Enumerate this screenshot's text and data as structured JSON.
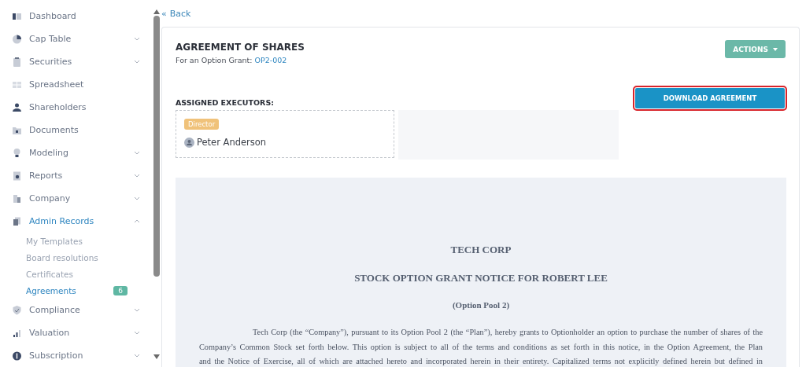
{
  "sidebar": {
    "items": [
      {
        "label": "Dashboard",
        "has_submenu": false,
        "expanded": false,
        "selected": false
      },
      {
        "label": "Cap Table",
        "has_submenu": true,
        "expanded": false,
        "selected": false
      },
      {
        "label": "Securities",
        "has_submenu": true,
        "expanded": false,
        "selected": false
      },
      {
        "label": "Spreadsheet",
        "has_submenu": false,
        "expanded": false,
        "selected": false
      },
      {
        "label": "Shareholders",
        "has_submenu": false,
        "expanded": false,
        "selected": false
      },
      {
        "label": "Documents",
        "has_submenu": false,
        "expanded": false,
        "selected": false
      },
      {
        "label": "Modeling",
        "has_submenu": true,
        "expanded": false,
        "selected": false
      },
      {
        "label": "Reports",
        "has_submenu": true,
        "expanded": false,
        "selected": false
      },
      {
        "label": "Company",
        "has_submenu": true,
        "expanded": false,
        "selected": false
      },
      {
        "label": "Admin Records",
        "has_submenu": true,
        "expanded": true,
        "selected": true,
        "children": [
          {
            "label": "My Templates",
            "selected": false
          },
          {
            "label": "Board resolutions",
            "selected": false
          },
          {
            "label": "Certificates",
            "selected": false
          },
          {
            "label": "Agreements",
            "selected": true,
            "badge": "6"
          }
        ]
      },
      {
        "label": "Compliance",
        "has_submenu": true,
        "expanded": false,
        "selected": false
      },
      {
        "label": "Valuation",
        "has_submenu": true,
        "expanded": false,
        "selected": false
      },
      {
        "label": "Subscription",
        "has_submenu": true,
        "expanded": false,
        "selected": false
      }
    ]
  },
  "back_link": {
    "icon": "«",
    "label": "Back"
  },
  "agreement": {
    "title": "AGREEMENT OF SHARES",
    "subtitle": "For an Option Grant:",
    "grant_id": "OP2-002",
    "actions_button": "ACTIONS",
    "download_button": {
      "label": "DOWNLOAD AGREEMENT",
      "highlighted": true
    },
    "executors_label": "ASSIGNED EXECUTORS:",
    "executors": [
      {
        "role": "Director",
        "name": "Peter Anderson"
      }
    ]
  },
  "document": {
    "company": "TECH CORP",
    "heading": "STOCK OPTION GRANT NOTICE FOR ROBERT LEE",
    "pool": "(Option Pool 2)",
    "paragraph_lines": [
      "Tech Corp (the “Company”), pursuant to its Option Pool 2 (the “Plan”), hereby grants to Optionholder an option to purchase the number of shares of the",
      "Company’s Common Stock set forth below. This option is subject to all of the terms and conditions as set forth in this notice, in the Option Agreement, the Plan",
      "and the Notice of Exercise, all of which are attached hereto and incorporated herein in their entirety. Capitalized terms not explicitly defined herein but defined in"
    ]
  }
}
